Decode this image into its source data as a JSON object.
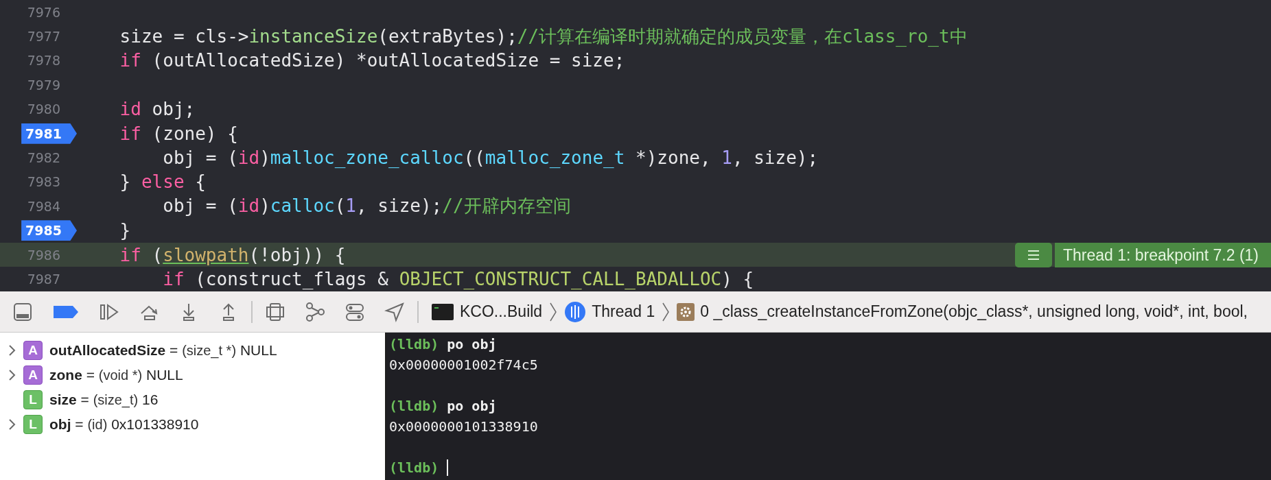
{
  "editor": {
    "lines": [
      {
        "number": "7976",
        "breakpoint": false,
        "current": false
      },
      {
        "number": "7977",
        "breakpoint": false,
        "current": false,
        "tokens": [
          {
            "kind": "plain",
            "text": "    size = cls->"
          },
          {
            "kind": "method",
            "text": "instanceSize"
          },
          {
            "kind": "plain",
            "text": "(extraBytes);"
          },
          {
            "kind": "comment",
            "text": "//计算在编译时期就确定的成员变量，在class_ro_t中"
          }
        ]
      },
      {
        "number": "7978",
        "breakpoint": false,
        "current": false,
        "tokens": [
          {
            "kind": "keyword",
            "text": "    if"
          },
          {
            "kind": "plain",
            "text": " (outAllocatedSize) *outAllocatedSize = size;"
          }
        ]
      },
      {
        "number": "7979",
        "breakpoint": false,
        "current": false
      },
      {
        "number": "7980",
        "breakpoint": false,
        "current": false,
        "tokens": [
          {
            "kind": "keyword",
            "text": "    id"
          },
          {
            "kind": "plain",
            "text": " obj;"
          }
        ]
      },
      {
        "number": "7981",
        "breakpoint": true,
        "current": false,
        "tokens": [
          {
            "kind": "keyword",
            "text": "    if"
          },
          {
            "kind": "plain",
            "text": " (zone) {"
          }
        ]
      },
      {
        "number": "7982",
        "breakpoint": false,
        "current": false,
        "tokens": [
          {
            "kind": "plain",
            "text": "        obj = ("
          },
          {
            "kind": "keyword",
            "text": "id"
          },
          {
            "kind": "plain",
            "text": ")"
          },
          {
            "kind": "function",
            "text": "malloc_zone_calloc"
          },
          {
            "kind": "plain",
            "text": "(("
          },
          {
            "kind": "function",
            "text": "malloc_zone_t"
          },
          {
            "kind": "plain",
            "text": " *)zone, "
          },
          {
            "kind": "number",
            "text": "1"
          },
          {
            "kind": "plain",
            "text": ", size);"
          }
        ]
      },
      {
        "number": "7983",
        "breakpoint": false,
        "current": false,
        "tokens": [
          {
            "kind": "plain",
            "text": "    } "
          },
          {
            "kind": "keyword",
            "text": "else"
          },
          {
            "kind": "plain",
            "text": " {"
          }
        ]
      },
      {
        "number": "7984",
        "breakpoint": false,
        "current": false,
        "tokens": [
          {
            "kind": "plain",
            "text": "        obj = ("
          },
          {
            "kind": "keyword",
            "text": "id"
          },
          {
            "kind": "plain",
            "text": ")"
          },
          {
            "kind": "function",
            "text": "calloc"
          },
          {
            "kind": "plain",
            "text": "("
          },
          {
            "kind": "number",
            "text": "1"
          },
          {
            "kind": "plain",
            "text": ", size);"
          },
          {
            "kind": "comment",
            "text": "//开辟内存空间"
          }
        ]
      },
      {
        "number": "7985",
        "breakpoint": true,
        "current": false,
        "tokens": [
          {
            "kind": "plain",
            "text": "    }"
          }
        ]
      },
      {
        "number": "7986",
        "breakpoint": false,
        "current": true,
        "tokens": [
          {
            "kind": "keyword",
            "text": "    if"
          },
          {
            "kind": "plain",
            "text": " ("
          },
          {
            "kind": "macro-call",
            "text": "slowpath"
          },
          {
            "kind": "plain",
            "text": "(!obj)) {"
          }
        ]
      },
      {
        "number": "7987",
        "breakpoint": false,
        "current": false,
        "tokens": [
          {
            "kind": "keyword",
            "text": "        if"
          },
          {
            "kind": "plain",
            "text": " (construct_flags & "
          },
          {
            "kind": "macro",
            "text": "OBJECT_CONSTRUCT_CALL_BADALLOC"
          },
          {
            "kind": "plain",
            "text": ") {"
          }
        ]
      }
    ],
    "annotation": {
      "text": "Thread 1: breakpoint 7.2 (1)"
    }
  },
  "debug_bar": {
    "breakpoints_active": true,
    "breadcrumbs": [
      {
        "kind": "target",
        "text": "KCO...Build"
      },
      {
        "kind": "thread",
        "text": "Thread 1"
      },
      {
        "kind": "frame",
        "text": "0 _class_createInstanceFromZone(objc_class*, unsigned long, void*, int, bool,"
      }
    ]
  },
  "variables": [
    {
      "expandable": true,
      "badge": "A",
      "kind": "argument",
      "name": "outAllocatedSize",
      "operator": "=",
      "type": "(size_t *)",
      "value": "NULL"
    },
    {
      "expandable": true,
      "badge": "A",
      "kind": "argument",
      "name": "zone",
      "operator": "=",
      "type": "(void *)",
      "value": "NULL"
    },
    {
      "expandable": false,
      "badge": "L",
      "kind": "local",
      "name": "size",
      "operator": "=",
      "type": "(size_t)",
      "value": "16"
    },
    {
      "expandable": true,
      "badge": "L",
      "kind": "local",
      "name": "obj",
      "operator": "=",
      "type": "(id)",
      "value": "0x101338910"
    }
  ],
  "console": [
    {
      "kind": "prompt",
      "prompt": "(lldb)",
      "command": "po obj"
    },
    {
      "kind": "output",
      "text": "0x00000001002f74c5"
    },
    {
      "kind": "blank"
    },
    {
      "kind": "prompt",
      "prompt": "(lldb)",
      "command": "po obj"
    },
    {
      "kind": "output",
      "text": "0x0000000101338910"
    },
    {
      "kind": "blank"
    },
    {
      "kind": "input",
      "prompt": "(lldb)"
    }
  ]
}
